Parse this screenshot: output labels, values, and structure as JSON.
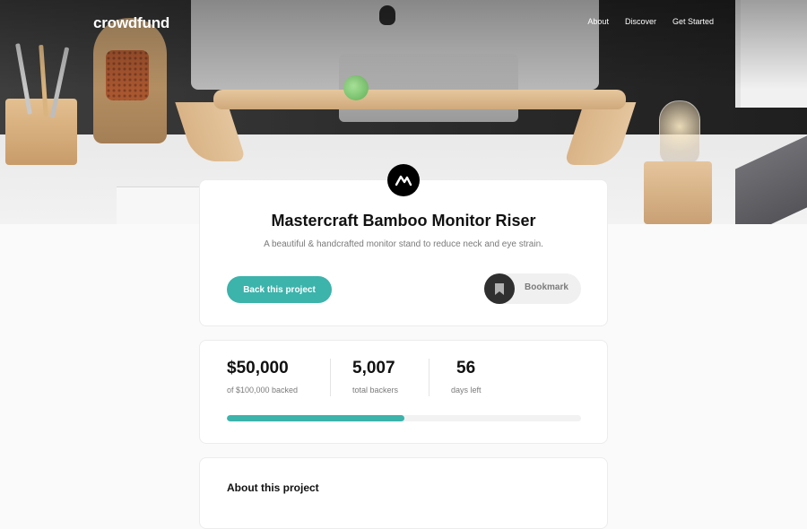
{
  "nav": {
    "logo": "crowdfund",
    "links": [
      {
        "label": "About"
      },
      {
        "label": "Discover"
      },
      {
        "label": "Get Started"
      }
    ]
  },
  "project": {
    "title": "Mastercraft Bamboo Monitor Riser",
    "description": "A beautiful & handcrafted monitor stand to reduce neck and eye strain.",
    "back_button_label": "Back this project",
    "bookmark_label": "Bookmark",
    "brand_mark_icon": "mastercraft-logo-icon"
  },
  "stats": {
    "backed": {
      "value": "$50,000",
      "label": "of $100,000 backed"
    },
    "backers": {
      "value": "5,007",
      "label": "total backers"
    },
    "days": {
      "value": "56",
      "label": "days left"
    },
    "progress_fraction": 0.5
  },
  "about": {
    "title": "About this project"
  },
  "colors": {
    "accent": "#3cb3ab",
    "dark": "#2f2f2f"
  }
}
